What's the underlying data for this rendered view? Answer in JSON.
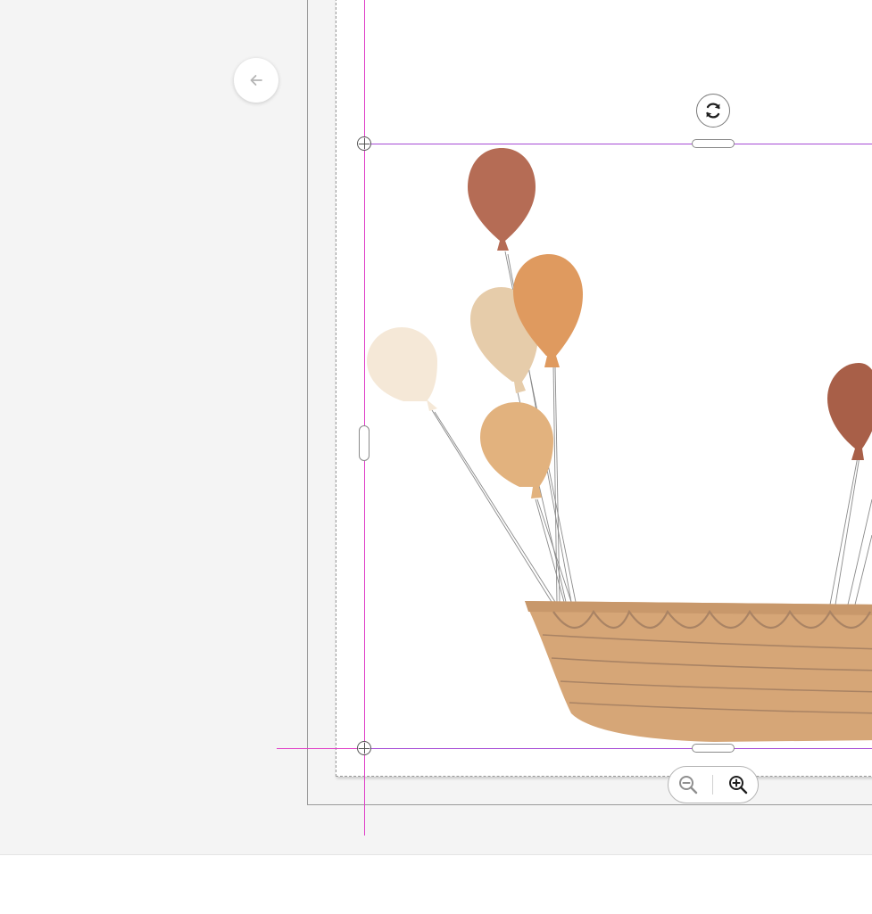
{
  "canvas": {
    "background": "#f4f4f4",
    "page_background": "#ffffff",
    "guide_color": "#a64bd6",
    "snap_color": "#e040c8"
  },
  "controls": {
    "back_icon": "arrow-left-icon",
    "rotate_icon": "rotate-icon",
    "zoom_out_icon": "zoom-out-icon",
    "zoom_in_icon": "zoom-in-icon"
  },
  "artwork": {
    "subject": "balloons-and-boat",
    "colors": {
      "balloon_rust": "#b56c55",
      "balloon_orange": "#df9a5f",
      "balloon_sand": "#e6ccaa",
      "balloon_cream": "#f5e8d7",
      "balloon_tan": "#e2b27e",
      "boat": "#d6a677",
      "boat_stripe": "#a98364",
      "string": "#8a8a8a"
    }
  }
}
